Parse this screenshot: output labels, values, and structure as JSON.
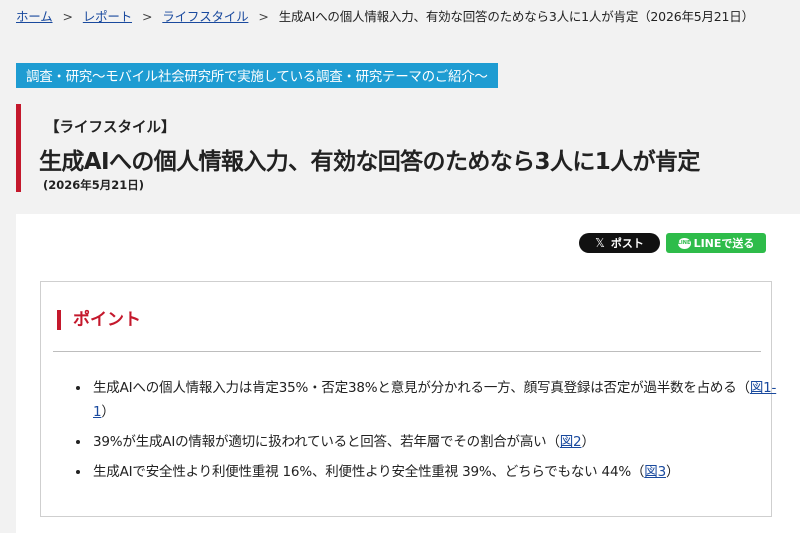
{
  "breadcrumb": {
    "home": "ホーム",
    "sep": ">",
    "report": "レポート",
    "lifestyle": "ライフスタイル",
    "current": "生成AIへの個人情報入力、有効な回答のためなら3人に1人が肯定（2026年5月21日）"
  },
  "banner": "調査・研究～モバイル社会研究所で実施している調査・研究テーマのご紹介～",
  "article": {
    "category": "【ライフスタイル】",
    "title": "生成AIへの個人情報入力、有効な回答のためなら3人に1人が肯定",
    "date": "(2026年5月21日)"
  },
  "share": {
    "x_icon": "𝕏",
    "x_label": "ポスト",
    "line_icon": "LINE",
    "line_label": "LINEで送る"
  },
  "points": {
    "heading": "ポイント",
    "items": [
      {
        "text": "生成AIへの個人情報入力は肯定35%・否定38%と意見が分かれる一方、顔写真登録は否定が過半数を占める（",
        "link": "図1-1",
        "close": "）"
      },
      {
        "text": "39%が生成AIの情報が適切に扱われていると回答、若年層でその割合が高い（",
        "link": "図2",
        "close": "）"
      },
      {
        "text": "生成AIで安全性より利便性重視 16%、利便性より安全性重視 39%、どちらでもない 44%（",
        "link": "図3",
        "close": "）"
      }
    ]
  },
  "colors": {
    "accent_red": "#c4182c",
    "banner_blue": "#1e9cd2",
    "line_green": "#2ebc4a",
    "link_blue": "#1a4a9e"
  }
}
